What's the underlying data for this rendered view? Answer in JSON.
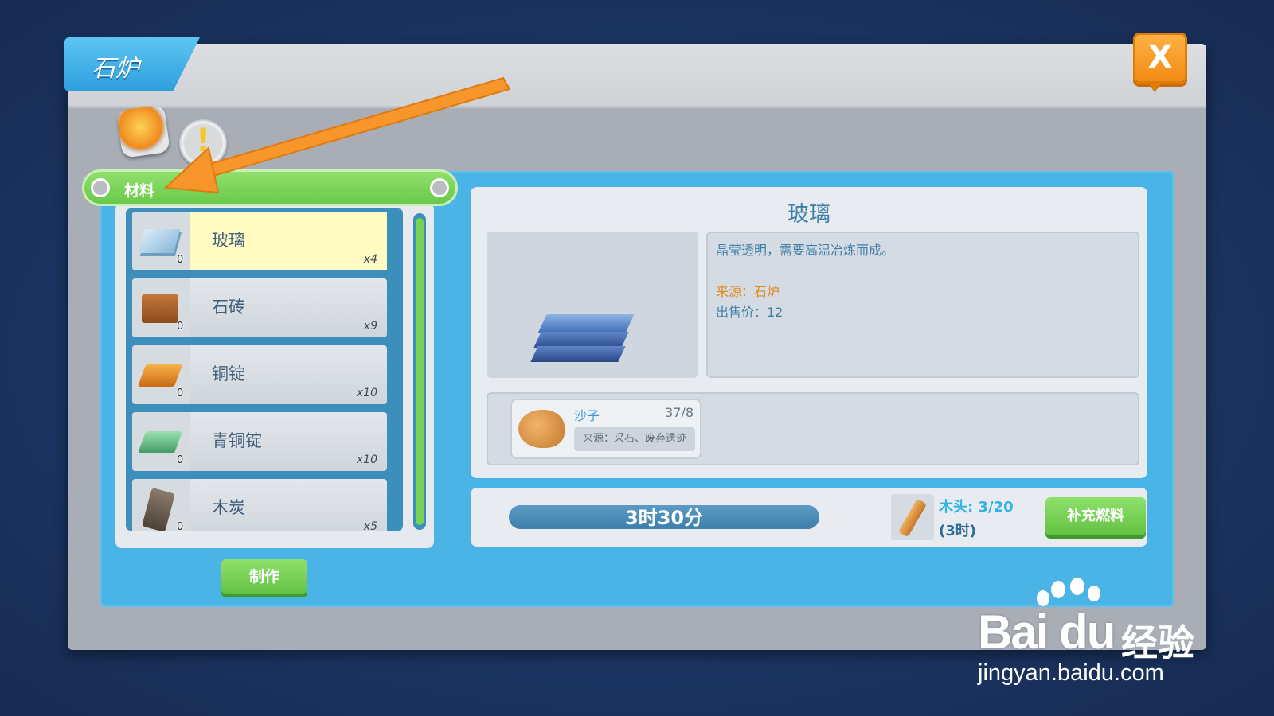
{
  "window": {
    "title": "石炉",
    "close_label": "X"
  },
  "category": {
    "header_label": "材料",
    "hint_symbol": "!"
  },
  "items": [
    {
      "name": "玻璃",
      "count": "x4",
      "owned": "0",
      "selected": true,
      "color": "#9fc8e6"
    },
    {
      "name": "石砖",
      "count": "x9",
      "owned": "0",
      "selected": false,
      "color": "#b5652a"
    },
    {
      "name": "铜锭",
      "count": "x10",
      "owned": "0",
      "selected": false,
      "color": "#e08a2a"
    },
    {
      "name": "青铜锭",
      "count": "x10",
      "owned": "0",
      "selected": false,
      "color": "#5fbf87"
    },
    {
      "name": "木炭",
      "count": "x5",
      "owned": "0",
      "selected": false,
      "color": "#6b5b4f"
    }
  ],
  "make_button": "制作",
  "detail": {
    "title": "玻璃",
    "description": "晶莹透明，需要高温冶炼而成。",
    "source": "来源：石炉",
    "price": "出售价：12"
  },
  "ingredient": {
    "name": "沙子",
    "qty": "37/8",
    "source": "来源：采石、废弃遗迹"
  },
  "fuel": {
    "time_remaining": "3时30分",
    "progress": 1.0,
    "wood_label": "木头: 3/20",
    "wood_time": "(3时)",
    "refuel_button": "补充燃料"
  },
  "watermark": {
    "logo": "Bai du",
    "brand": "经验",
    "url": "jingyan.baidu.com"
  },
  "colors": {
    "accent_blue": "#4bb4e6",
    "accent_green": "#78d254",
    "accent_orange": "#f28b12"
  }
}
